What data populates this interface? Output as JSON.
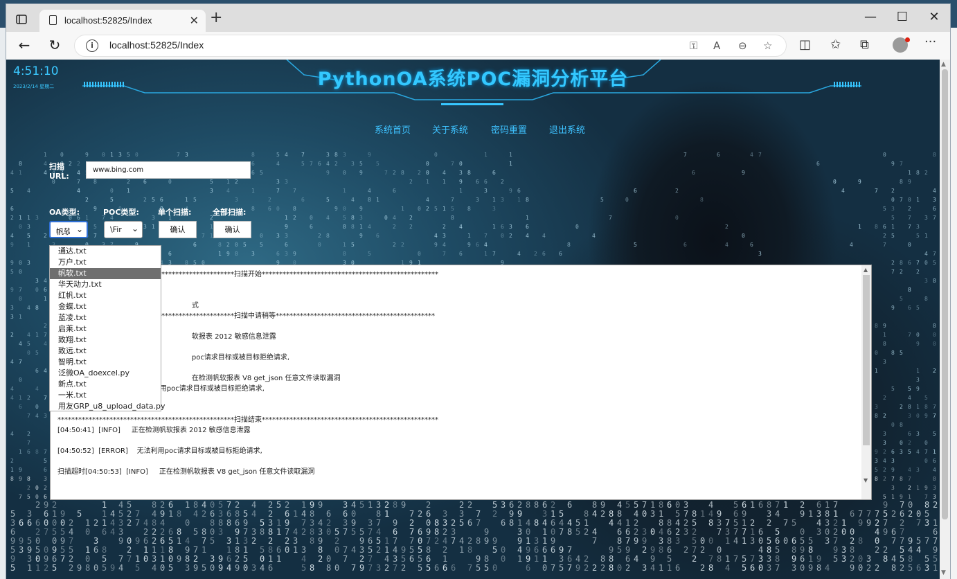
{
  "browser": {
    "tab_title": "localhost:52825/Index",
    "url": "localhost:52825/Index",
    "new_tab": "+",
    "tab_close": "✕",
    "minimize": "—",
    "maximize": "☐",
    "close": "✕"
  },
  "header": {
    "title": "PythonOA系统POC漏洞分析平台",
    "clock": "4:51:10",
    "date": "2023/2/14 星期二"
  },
  "nav": [
    "系统首页",
    "关于系统",
    "密码重置",
    "退出系统"
  ],
  "form": {
    "url_label": "扫描URL:",
    "url_value": "www.bing.com",
    "oa_label": "OA类型:",
    "poc_label": "POC类型:",
    "single_label": "单个扫描:",
    "all_label": "全部扫描:",
    "oa_selected": "帆软",
    "poc_selected": "\\Fir",
    "single_btn": "确认",
    "all_btn": "确认"
  },
  "oa_options": [
    "通达.txt",
    "万户.txt",
    "帆软.txt",
    "华天动力.txt",
    "红帆.txt",
    "金蝶.txt",
    "蓝凌.txt",
    "启莱.txt",
    "致翔.txt",
    "致远.txt",
    "智明.txt",
    "泛微OA_doexcel.py",
    "新点.txt",
    "一米.txt",
    "用友GRP_u8_upload_data.py"
  ],
  "oa_selected_index": 2,
  "output_lines": [
    "***************************************************扫描开始***************************************************",
    "",
    "",
    "                                                             式",
    "***************************************************扫描中请稍等**********************************************",
    "",
    "                                                             软报表 2012 敏感信息泄露",
    "",
    "                                                             poc请求目标或被目标拒绝请求,",
    "",
    "                                                             在检测帆软报表 V8 get_json 任意文件读取漏洞",
    "[04:50:53]  [ERROR]     无法利用poc请求目标或被目标拒绝请求,",
    "",
    "",
    "***************************************************扫描结束***************************************************",
    "[04:50:41]  [INFO]     正在检测帆软报表 2012 敏感信息泄露",
    "",
    "[04:50:52]  [ERROR]    无法利用poc请求目标或被目标拒绝请求,",
    "",
    "扫描超时[04:50:53]  [INFO]     正在检测帆软报表 V8 get_json 任意文件读取漏洞"
  ]
}
